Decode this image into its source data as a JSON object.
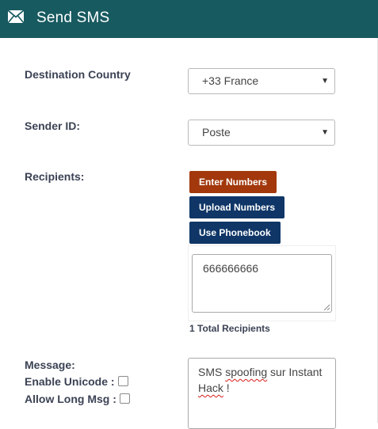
{
  "header": {
    "title": "Send SMS"
  },
  "destination": {
    "label": "Destination Country",
    "value": "+33 France"
  },
  "sender": {
    "label": "Sender ID:",
    "value": "Poste"
  },
  "recipients": {
    "label": "Recipients:",
    "buttons": {
      "enter": "Enter Numbers",
      "upload": "Upload Numbers",
      "phonebook": "Use Phonebook"
    },
    "numbers": "666666666",
    "total_count": "1",
    "total_label": "Total Recipients"
  },
  "message": {
    "label": "Message:",
    "unicode_label": "Enable Unicode :",
    "long_label": "Allow Long Msg :",
    "text_part1": "SMS ",
    "text_misspelled1": "spoofing",
    "text_part2": " sur Instant ",
    "text_misspelled2": "Hack",
    "text_part3": " !"
  }
}
